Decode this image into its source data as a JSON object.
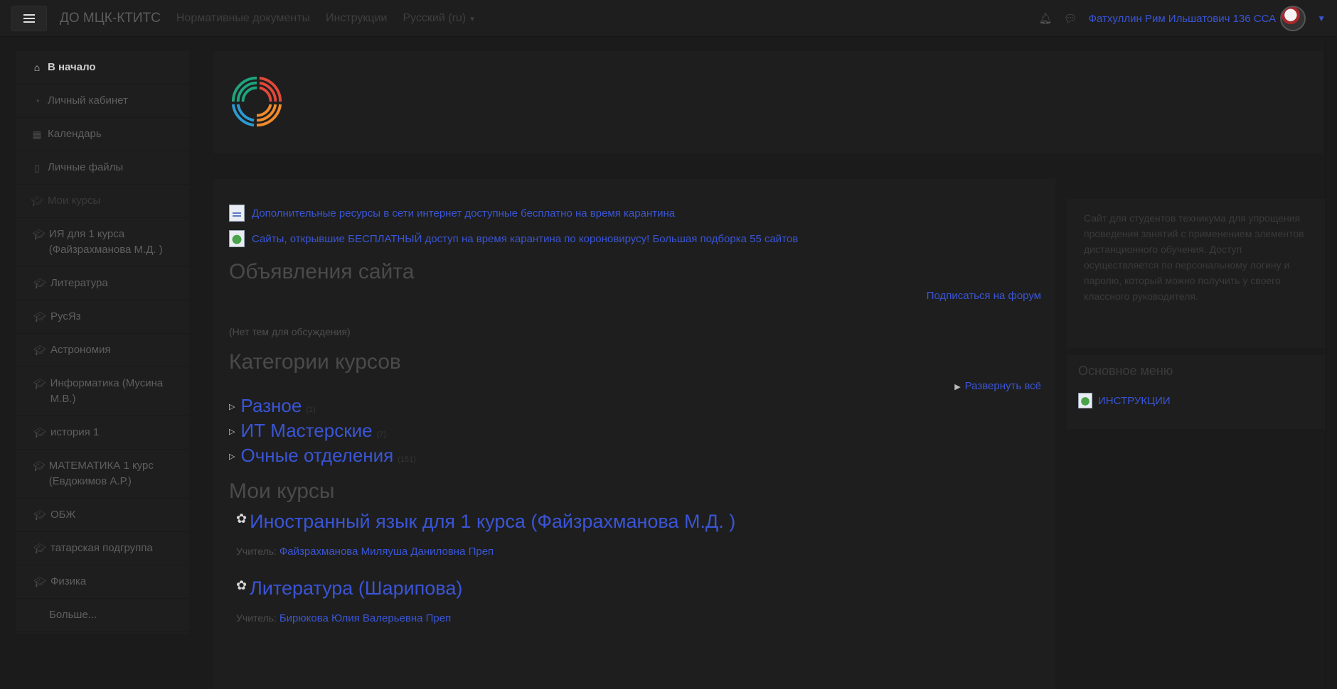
{
  "navbar": {
    "brand": "ДО МЦК-КТИТС",
    "links": [
      "Нормативные документы",
      "Инструкции",
      "Русский (ru)"
    ],
    "user_name": "Фатхуллин Рим Ильшатович 136 ССА"
  },
  "sidebar": {
    "items": [
      {
        "label": "В начало",
        "icon": "home-icon"
      },
      {
        "label": "Личный кабинет",
        "icon": "dashboard-icon"
      },
      {
        "label": "Календарь",
        "icon": "calendar-icon"
      },
      {
        "label": "Личные файлы",
        "icon": "file-icon"
      },
      {
        "label": "Мои курсы",
        "icon": "graduation-cap-icon"
      },
      {
        "label": "ИЯ для 1 курса (Файзрахманова М.Д. )",
        "icon": "graduation-cap-icon"
      },
      {
        "label": "Литература",
        "icon": "graduation-cap-icon"
      },
      {
        "label": "РусЯз",
        "icon": "graduation-cap-icon"
      },
      {
        "label": "Астрономия",
        "icon": "graduation-cap-icon"
      },
      {
        "label": "Информатика (Мусина М.В.)",
        "icon": "graduation-cap-icon"
      },
      {
        "label": "история 1",
        "icon": "graduation-cap-icon"
      },
      {
        "label": "МАТЕМАТИКА 1 курс (Евдокимов А.Р.)",
        "icon": "graduation-cap-icon"
      },
      {
        "label": "ОБЖ",
        "icon": "graduation-cap-icon"
      },
      {
        "label": "татарская подгруппа",
        "icon": "graduation-cap-icon"
      },
      {
        "label": "Физика",
        "icon": "graduation-cap-icon"
      },
      {
        "label": "Больше..."
      }
    ]
  },
  "main": {
    "resources": [
      "Дополнительные ресурсы в сети интернет доступные бесплатно на время карантина",
      "Сайты, открывшие БЕСПЛАТНЫЙ доступ на время карантина по короновирусу! Большая подборка 55 сайтов"
    ],
    "announcements_title": "Объявления сайта",
    "subscribe_link": "Подписаться на форум",
    "no_topics": "(Нет тем для обсуждения)",
    "categories_title": "Категории курсов",
    "expand_all": "Развернуть всё",
    "categories": [
      {
        "name": "Разное",
        "count": "(1)"
      },
      {
        "name": "ИТ Мастерские",
        "count": "(7)"
      },
      {
        "name": "Очные отделения",
        "count": "(151)"
      }
    ],
    "my_courses_title": "Мои курсы",
    "courses": [
      {
        "title": "Иностранный язык для 1 курса (Файзрахманова М.Д. )",
        "teacher_label": "Учитель:",
        "teacher": "Файзрахманова Миляуша Даниловна Преп"
      },
      {
        "title": "Литература (Шарипова)",
        "teacher_label": "Учитель:",
        "teacher": "Бирюкова Юлия Валерьевна Преп"
      }
    ]
  },
  "right": {
    "description": "Сайт для студентов техникума для упрощения проведения занятий с применением элементов дистанционного обучения. Доступ осуществляется по персональному логину и паролю, который можно получить у своего классного руководителя.",
    "menu_title": "Основное меню",
    "menu_item": "ИНСТРУКЦИИ"
  }
}
